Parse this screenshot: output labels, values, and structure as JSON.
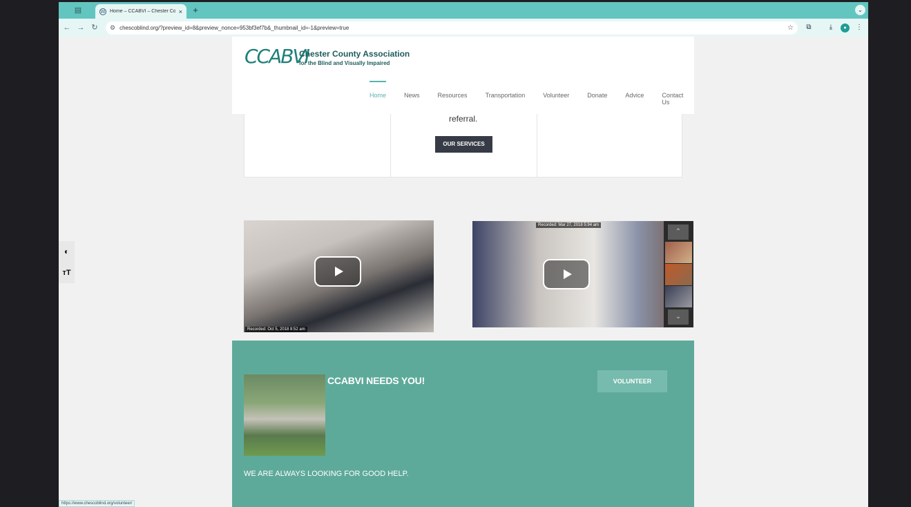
{
  "browser": {
    "tab_title": "Home – CCABVI – Chester Co",
    "tab_close": "×",
    "new_tab": "+",
    "url": "chescoblind.org/?preview_id=8&preview_nonce=953bf3ef7b&_thumbnail_id=-1&preview=true",
    "status_url": "https://www.chescoblind.org/volunteer/"
  },
  "site": {
    "logo_mark": "CCABVI",
    "org_name": "Chester County Association",
    "org_tagline": "for the Blind and Visually Impaired",
    "nav": [
      {
        "label": "Home"
      },
      {
        "label": "News"
      },
      {
        "label": "Resources"
      },
      {
        "label": "Transportation"
      },
      {
        "label": "Volunteer"
      },
      {
        "label": "Donate"
      },
      {
        "label": "Advice"
      },
      {
        "label": "Contact Us"
      }
    ]
  },
  "services": {
    "text": "referral.",
    "button_label": "OUR SERVICES"
  },
  "videos": {
    "video1_stamp": "Recorded: Oct 5, 2018 8:52 am",
    "video2_stamp": "Recorded: Mar 27, 2018 5:94 am"
  },
  "volunteer": {
    "title": "CCABVI NEEDS YOU!",
    "button_label": "VOLUNTEER",
    "text": "WE ARE ALWAYS LOOKING FOR GOOD HELP."
  },
  "a11y": {
    "contrast_glyph": "◐",
    "textsize_glyph": "тT"
  },
  "colors": {
    "accent": "#57b3ac",
    "section_bg": "#5eaa9a",
    "button_dark": "#363b46"
  }
}
